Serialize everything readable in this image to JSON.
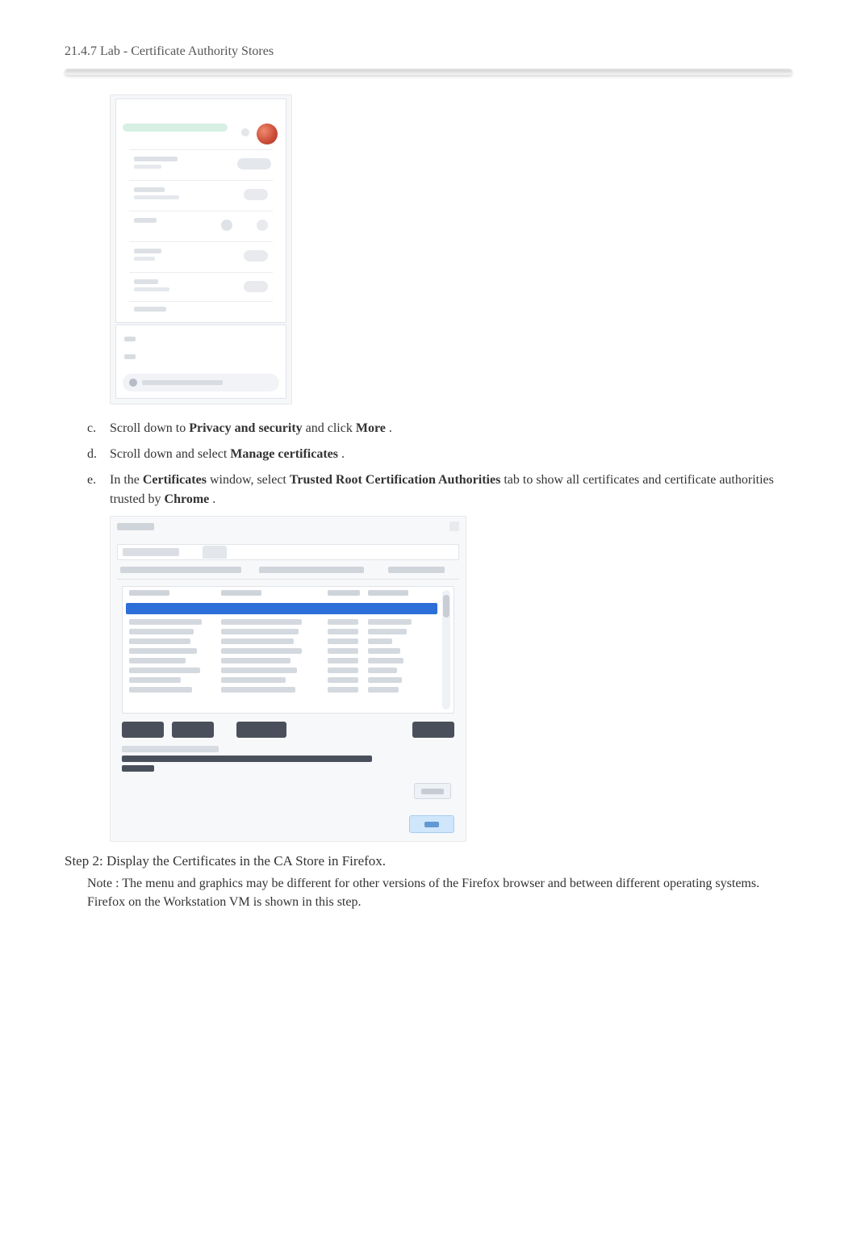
{
  "header": {
    "title": "21.4.7 Lab - Certificate Authority Stores"
  },
  "instructions": {
    "c": {
      "marker": "c.",
      "t1": "Scroll down to ",
      "b1": "Privacy and security",
      "t2": " and click ",
      "b2": "More",
      "t3": "."
    },
    "d": {
      "marker": "d.",
      "t1": "Scroll down and select ",
      "b1": "Manage certificates",
      "t2": "."
    },
    "e": {
      "marker": "e.",
      "t1": "In the ",
      "b1": "Certificates",
      "t2": " window, select ",
      "b2": "Trusted Root Certification Authorities",
      "t3": " tab to show all certificates and certificate authorities trusted by ",
      "b3": "Chrome",
      "t4": "."
    }
  },
  "step2": {
    "heading": "Step 2: Display the Certificates in the CA Store in Firefox."
  },
  "note": {
    "b1": "Note",
    "t1": ": The menu and graphics may be different for other versions of the Firefox browser and between different operating systems. ",
    "b2": "Firefox",
    "t2": " on the ",
    "b3": "Workstation",
    "t3": " VM is shown in this step."
  },
  "footer": {
    "left": "",
    "center": "",
    "right": ""
  }
}
